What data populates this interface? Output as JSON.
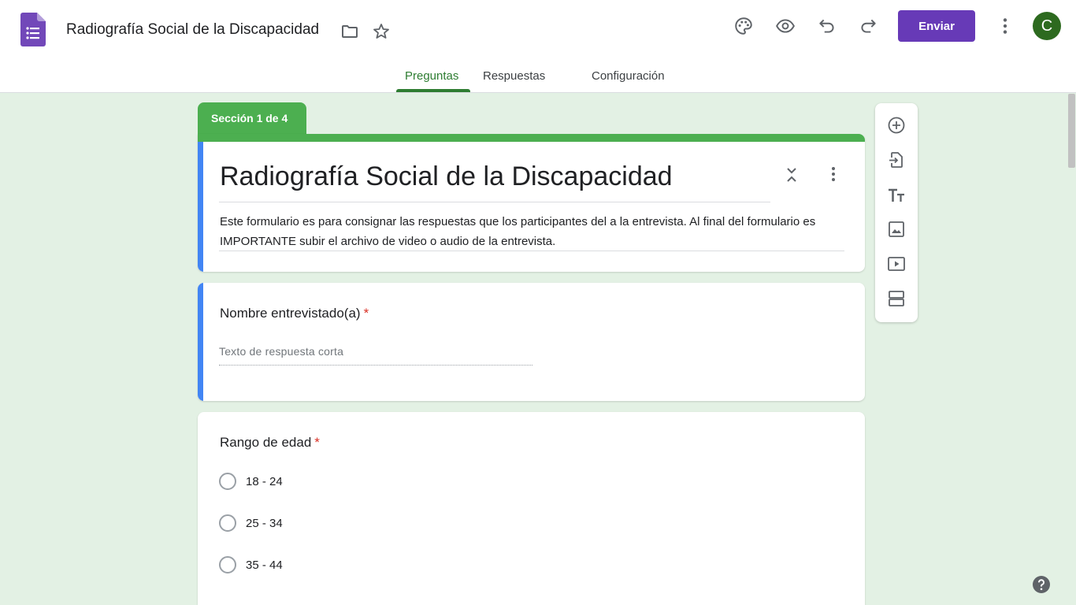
{
  "header": {
    "doc_title": "Radiografía Social de la Discapacidad",
    "send_label": "Enviar",
    "avatar_initial": "C",
    "accent_color": "#673ab7"
  },
  "tabs": [
    {
      "label": "Preguntas",
      "active": true
    },
    {
      "label": "Respuestas",
      "active": false
    },
    {
      "label": "Configuración",
      "active": false
    }
  ],
  "section": {
    "label": "Sección 1 de 4",
    "color": "#4caf50"
  },
  "form": {
    "title": "Radiografía Social de la Discapacidad",
    "description": "Este formulario es para consignar las respuestas que los participantes del a la entrevista. Al final del formulario es IMPORTANTE subir el archivo de video o audio de la entrevista."
  },
  "questions": [
    {
      "title": "Nombre entrevistado(a)",
      "required_mark": "*",
      "type": "short-answer",
      "placeholder": "Texto de respuesta corta"
    },
    {
      "title": "Rango de edad",
      "required_mark": "*",
      "type": "multiple-choice",
      "options": [
        "18 - 24",
        "25 - 34",
        "35 - 44"
      ]
    }
  ],
  "toolbar": {
    "icons": [
      "add-question-icon",
      "import-questions-icon",
      "add-title-icon",
      "add-image-icon",
      "add-video-icon",
      "add-section-icon"
    ]
  },
  "icons": {
    "header": [
      "palette-icon",
      "preview-icon",
      "undo-icon",
      "redo-icon",
      "more-vert-icon"
    ],
    "help": "help-icon"
  }
}
